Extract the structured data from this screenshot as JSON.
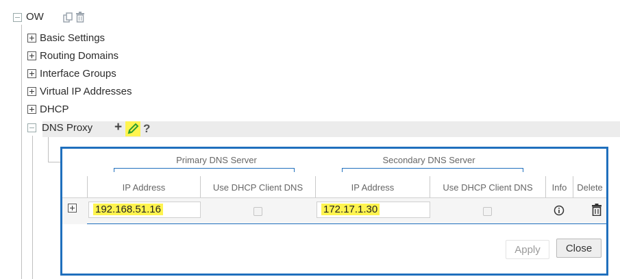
{
  "tree": {
    "root_label": "OW",
    "items": [
      {
        "label": "Basic Settings"
      },
      {
        "label": "Routing Domains"
      },
      {
        "label": "Interface Groups"
      },
      {
        "label": "Virtual IP Addresses"
      },
      {
        "label": "DHCP"
      }
    ],
    "active_item": {
      "label": "DNS Proxy",
      "add_glyph": "+",
      "help_glyph": "?"
    }
  },
  "table": {
    "group_headers": [
      "Primary DNS Server",
      "Secondary DNS Server"
    ],
    "columns": [
      "IP Address",
      "Use DHCP Client DNS",
      "IP Address",
      "Use DHCP Client DNS",
      "Info",
      "Delete"
    ],
    "row": {
      "primary_ip": "192.168.51.16",
      "primary_use_dhcp": false,
      "secondary_ip": "172.17.1.30",
      "secondary_use_dhcp": false
    }
  },
  "buttons": {
    "apply": "Apply",
    "close": "Close"
  },
  "icons": [
    "tree-collapse-icon",
    "tree-expand-icon",
    "copy-icon",
    "trash-icon",
    "pencil-icon",
    "info-icon",
    "delete-icon"
  ],
  "colors": {
    "accent": "#1f6fbd",
    "highlight": "#fff44f",
    "selected_row": "#ececec",
    "pencil": "#2e9e2e"
  }
}
